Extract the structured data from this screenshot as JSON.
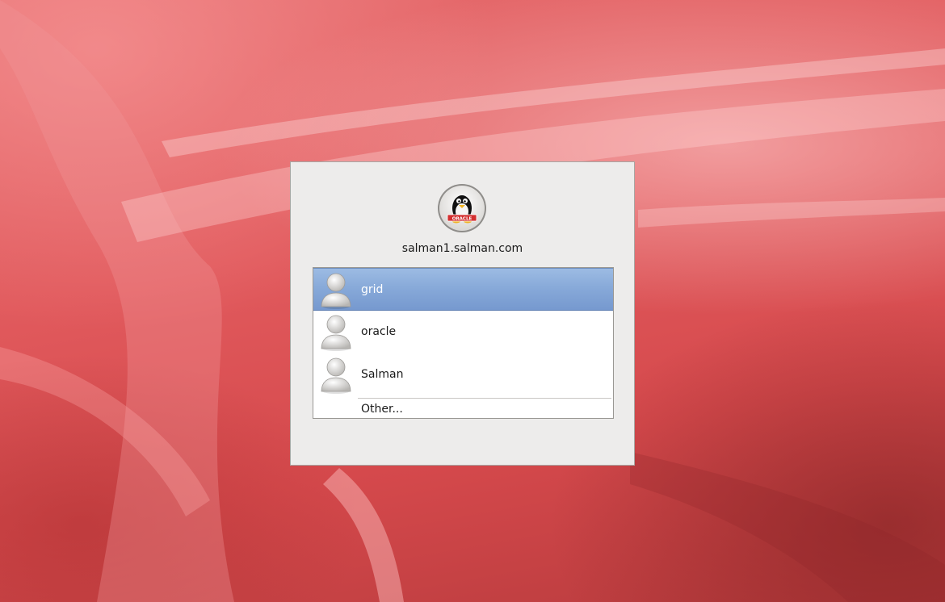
{
  "greeter": {
    "hostname": "salman1.salman.com",
    "logo_icon": "oracle-penguin-logo-icon",
    "users": [
      {
        "name": "grid",
        "icon": "user-avatar-icon",
        "selected": true
      },
      {
        "name": "oracle",
        "icon": "user-avatar-icon",
        "selected": false
      },
      {
        "name": "Salman",
        "icon": "user-avatar-icon",
        "selected": false
      }
    ],
    "other_label": "Other..."
  },
  "colors": {
    "wallpaper": "#e15a5d",
    "panel": "#edeceb",
    "selection": "#86a8d8",
    "logo_banner": "#d32f2f"
  },
  "logo": {
    "banner_text": "ORACLE"
  }
}
